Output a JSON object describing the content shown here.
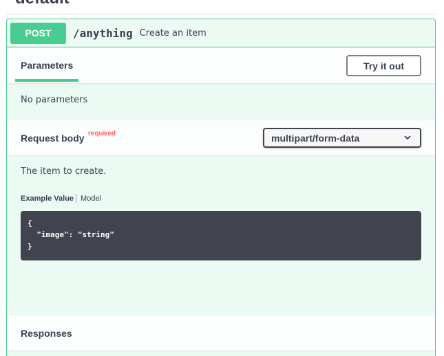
{
  "section": {
    "title": "default"
  },
  "operation": {
    "method": "POST",
    "path": "/anything",
    "summary": "Create an item"
  },
  "parameters": {
    "tab_label": "Parameters",
    "try_button": "Try it out",
    "empty_text": "No parameters"
  },
  "request_body": {
    "title": "Request body",
    "required_label": "required",
    "content_type": "multipart/form-data",
    "description": "The item to create.",
    "tabs": {
      "example": "Example Value",
      "model": "Model"
    },
    "example_code": "{\n  \"image\": \"string\"\n}"
  },
  "responses": {
    "title": "Responses"
  },
  "colors": {
    "post": "#49cc90",
    "required": "#ff6060",
    "code_bg": "#41444e"
  },
  "icons": {
    "content_type_dropdown": "chevron-down-icon"
  }
}
